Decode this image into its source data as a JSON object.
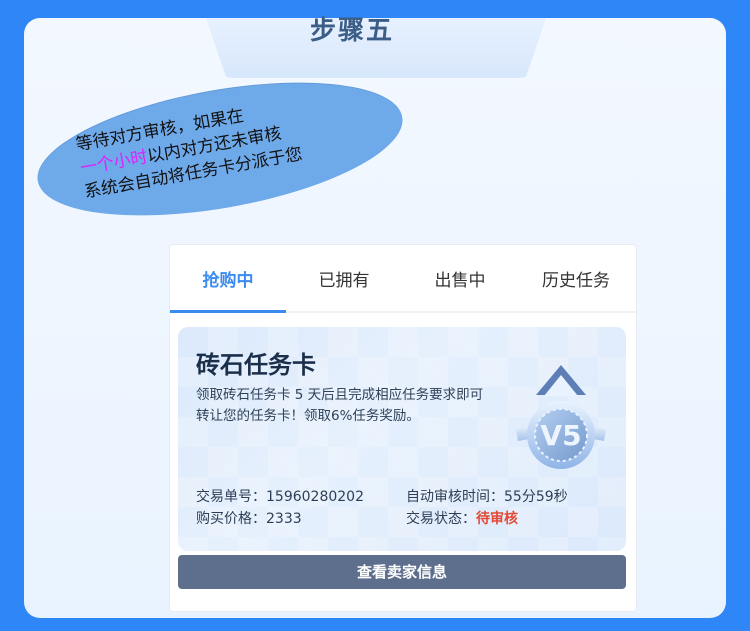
{
  "step": {
    "title": "步骤五"
  },
  "bubble": {
    "line1": "等待对方审核，如果在",
    "highlight": "一个小时",
    "line2_suffix": "以内对方还未审核",
    "line3": "系统会自动将任务卡分派于您"
  },
  "tabs": [
    {
      "label": "抢购中",
      "active": true
    },
    {
      "label": "已拥有",
      "active": false
    },
    {
      "label": "出售中",
      "active": false
    },
    {
      "label": "历史任务",
      "active": false
    }
  ],
  "task": {
    "title": "砖石任务卡",
    "desc_line1": "领取砖石任务卡 5 天后且完成相应任务要求即可",
    "desc_line2": "转让您的任务卡！领取6%任务奖励。",
    "medal_label": "V5",
    "order_label": "交易单号：",
    "order_value": "15960280202",
    "auto_review_label": "自动审核时间：",
    "auto_review_value": "55分59秒",
    "price_label": "购买价格：",
    "price_value": "2333",
    "status_label": "交易状态：",
    "status_value": "待审核"
  },
  "button": {
    "seller_info": "查看卖家信息"
  },
  "colors": {
    "page_bg": "#2f86f6",
    "accent": "#3b8bf0",
    "status": "#e24a35",
    "button": "#5d6f8d",
    "highlight_text": "#e020ff",
    "bubble": "#6ea9ea"
  }
}
